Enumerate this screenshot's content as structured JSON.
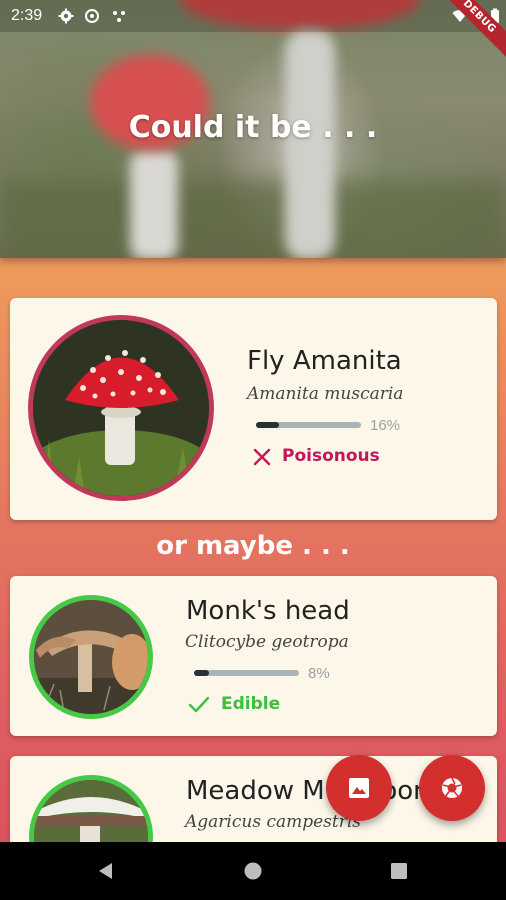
{
  "status_bar": {
    "time": "2:39"
  },
  "debug_banner": "DEBUG",
  "header": {
    "title": "Could it be . . ."
  },
  "primary_result": {
    "common_name": "Fly Amanita",
    "scientific_name": "Amanita muscaria",
    "confidence_label": "16%",
    "confidence": 0.16,
    "verdict": "Poisonous",
    "verdict_color": "#c2185b",
    "ring_color": "#c0395a"
  },
  "or_maybe_label": "or maybe . . .",
  "alternatives": [
    {
      "common_name": "Monk's head",
      "scientific_name": "Clitocybe geotropa",
      "confidence_label": "8%",
      "confidence": 0.08,
      "verdict": "Edible",
      "verdict_color": "#3cc03c",
      "ring_color": "#46c946"
    },
    {
      "common_name": "Meadow Mushroom",
      "scientific_name": "Agaricus campestris",
      "ring_color": "#46c946"
    }
  ],
  "actions": {
    "gallery_icon": "image-icon",
    "camera_icon": "camera-shutter-icon",
    "fab_color": "#d32f2f"
  },
  "nav": {
    "back_icon": "back-triangle-icon",
    "home_icon": "home-circle-icon",
    "recents_icon": "recents-square-icon"
  }
}
